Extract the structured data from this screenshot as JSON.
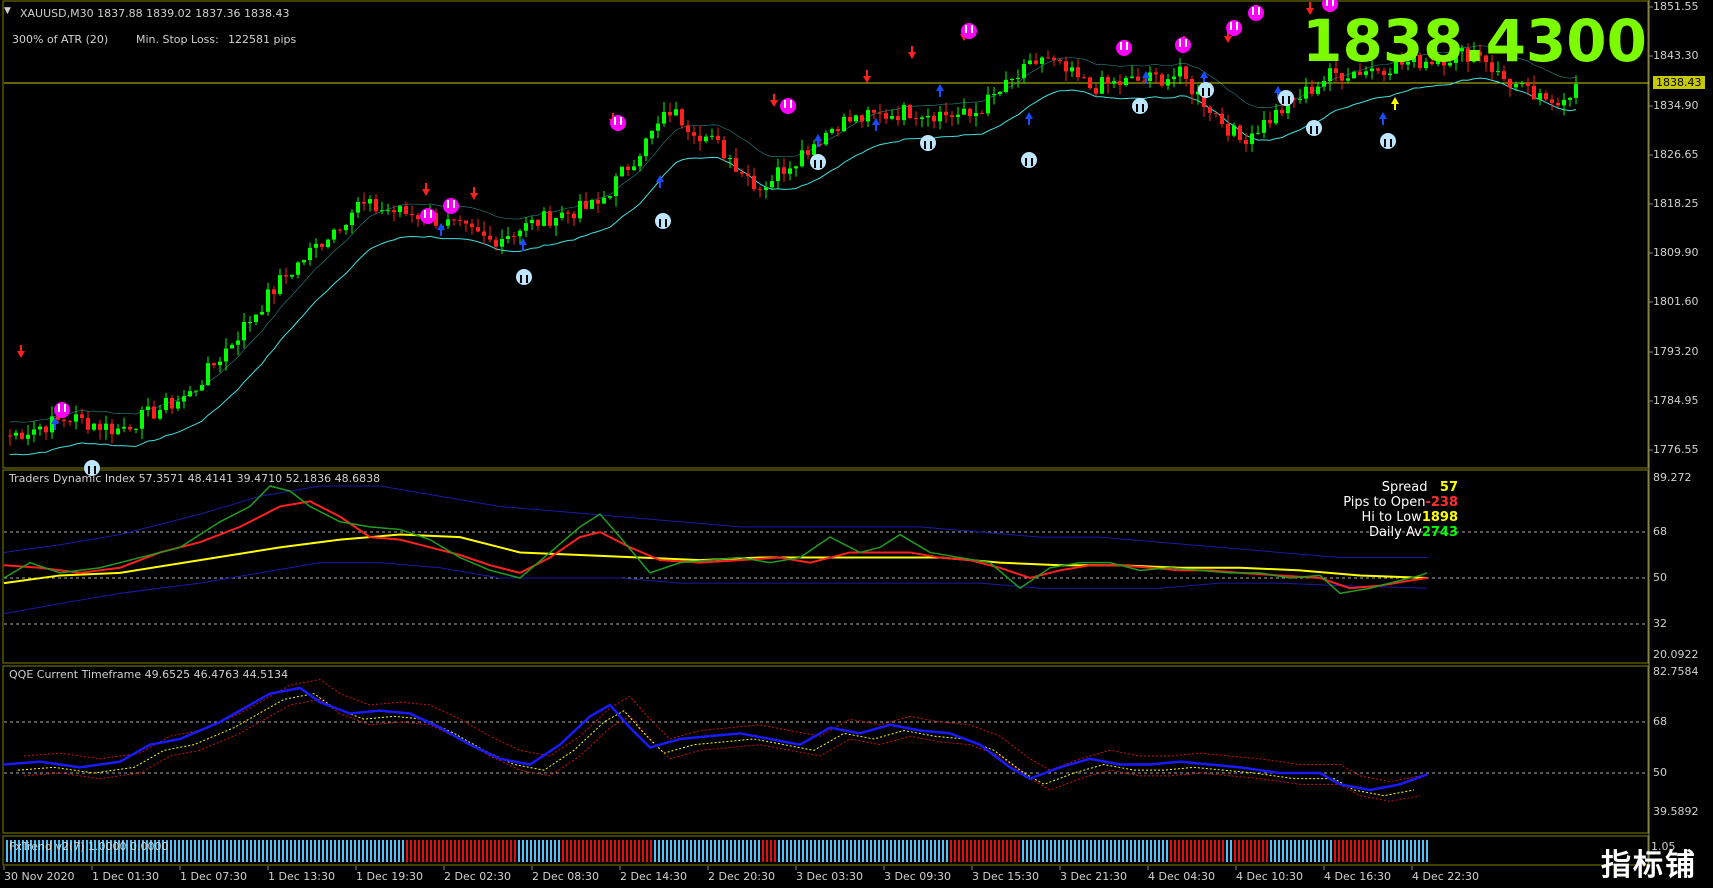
{
  "header": {
    "symbol_line": "XAUUSD,M30  1837.88 1839.02 1837.36 1838.43",
    "atr_text": "300% of ATR (20)",
    "stop_loss_label": "Min. Stop Loss:",
    "stop_loss_value": "122581 pips",
    "big_price": "1838.4300"
  },
  "price_axis": {
    "ticks": [
      "1851.55",
      "1843.30",
      "1834.90",
      "1826.65",
      "1818.25",
      "1809.90",
      "1801.60",
      "1793.20",
      "1784.95",
      "1776.55"
    ],
    "current_price_label": "1838.43"
  },
  "tdi_panel": {
    "title": "Traders Dynamic Index 57.3571 48.4141 39.4710 52.1836 48.6838",
    "axis_ticks": [
      "89.272",
      "68",
      "50",
      "32",
      "20.0922"
    ],
    "info": [
      {
        "label": "Spread",
        "value": "57",
        "color": "#ffff00"
      },
      {
        "label": "Pips to Open",
        "value": "-238",
        "color": "#ff3030"
      },
      {
        "label": "Hi to Low",
        "value": "1898",
        "color": "#ffff00"
      },
      {
        "label": "Daily Av",
        "value": "2743",
        "color": "#00ff00"
      }
    ]
  },
  "qqe_panel": {
    "title": "QQE Current Timeframe 49.6525 46.4763 44.5134",
    "axis_ticks": [
      "82.7584",
      "68",
      "50",
      "39.5892"
    ]
  },
  "fxtrend_panel": {
    "title": "FxTrend v2(7) 1.0000 0.0000",
    "axis_tick": "1.05",
    "colors": {
      "up": "#4fc3f7",
      "down": "#e01010"
    }
  },
  "time_axis": {
    "labels": [
      "30 Nov 2020",
      "1 Dec 01:30",
      "1 Dec 07:30",
      "1 Dec 13:30",
      "1 Dec 19:30",
      "2 Dec 02:30",
      "2 Dec 08:30",
      "2 Dec 14:30",
      "2 Dec 20:30",
      "3 Dec 03:30",
      "3 Dec 09:30",
      "3 Dec 15:30",
      "3 Dec 21:30",
      "4 Dec 04:30",
      "4 Dec 10:30",
      "4 Dec 16:30",
      "4 Dec 22:30"
    ]
  },
  "watermark": "指标铺",
  "colors": {
    "bull": "#00ff00",
    "bear": "#ff2020",
    "grid_border": "#808000",
    "price_line": "#c8c800",
    "envelope": "#40e0e0",
    "tdi_green": "#1e9e1e",
    "tdi_red": "#ff2020",
    "tdi_yellow": "#ffff00",
    "tdi_band": "#1a1aa8",
    "qqe_blue": "#1a1aff"
  }
}
